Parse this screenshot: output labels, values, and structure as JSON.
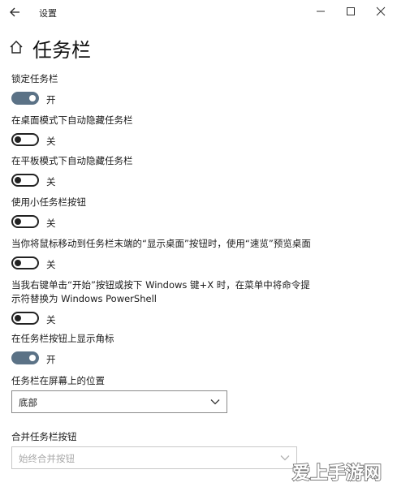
{
  "window": {
    "title": "设置"
  },
  "header": {
    "title": "任务栏"
  },
  "settings": [
    {
      "label": "锁定任务栏",
      "state": "开"
    },
    {
      "label": "在桌面模式下自动隐藏任务栏",
      "state": "关"
    },
    {
      "label": "在平板模式下自动隐藏任务栏",
      "state": "关"
    },
    {
      "label": "使用小任务栏按钮",
      "state": "关"
    },
    {
      "label": "当你将鼠标移动到任务栏末端的“显示桌面”按钮时，使用“速览”预览桌面",
      "state": "关"
    },
    {
      "label_line1": "当我右键单击“开始”按钮或按下 Windows 键+X 时，在菜单中将命令提",
      "label_line2": "示符替换为 Windows PowerShell",
      "state": "关"
    },
    {
      "label": "在任务栏按钮上显示角标",
      "state": "开"
    }
  ],
  "location": {
    "label": "任务栏在屏幕上的位置",
    "value": "底部"
  },
  "combine": {
    "label": "合并任务栏按钮",
    "value": "始终合并按钮"
  },
  "watermark": {
    "text": "爱上手游网"
  },
  "colors": {
    "toggle_on": "#5b7286",
    "toggle_off_border": "#222222",
    "dropdown_disabled": "#a8a8a8"
  },
  "icons": [
    "back-arrow-icon",
    "minimize-icon",
    "maximize-icon",
    "close-icon",
    "home-icon",
    "chevron-down-icon"
  ]
}
